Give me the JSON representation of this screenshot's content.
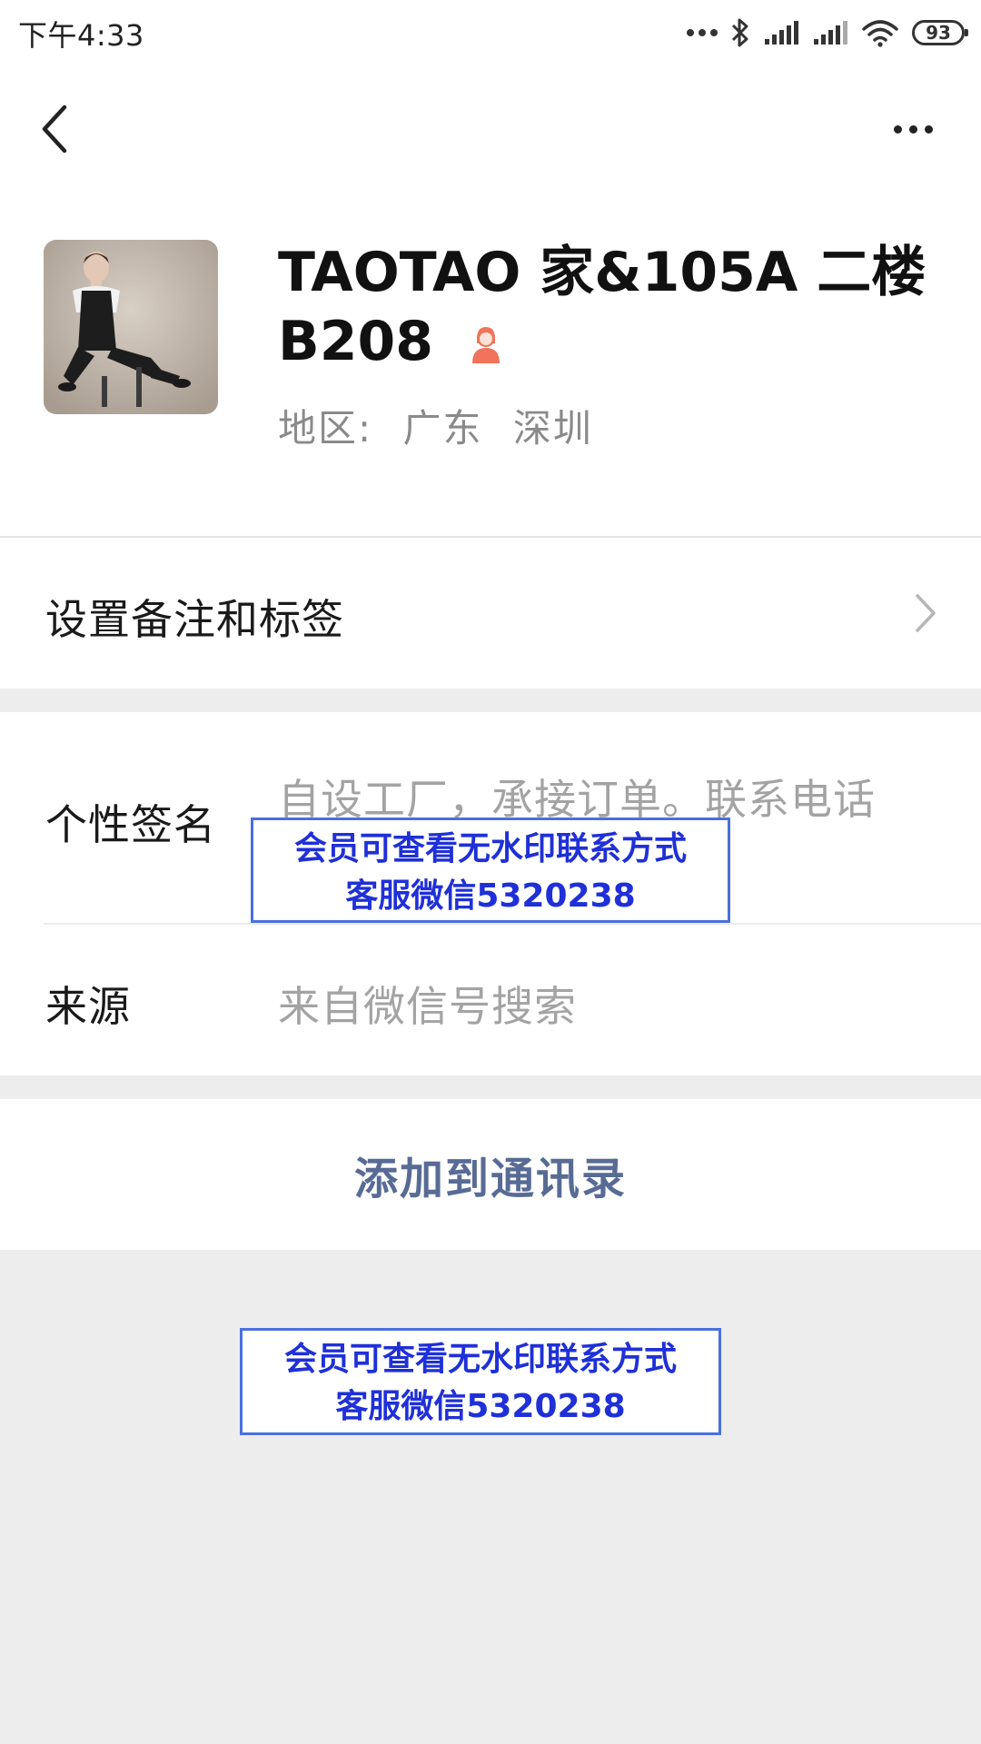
{
  "status_bar": {
    "time": "下午4:33",
    "battery": "93",
    "icons": [
      "more-dots-icon",
      "bluetooth-icon",
      "signal-icon",
      "signal-icon",
      "wifi-icon",
      "battery-icon"
    ]
  },
  "nav": {
    "back_icon": "chevron-left-icon",
    "more_icon": "more-icon"
  },
  "profile": {
    "name": "TAOTAO 家&105A 二楼 B208",
    "gender_icon": "female-icon",
    "gender_color": "#f0735a",
    "region_label": "地区:",
    "region_province": "广东",
    "region_city": "深圳"
  },
  "remark": {
    "label": "设置备注和标签"
  },
  "signature": {
    "label": "个性签名",
    "value": "自设工厂，承接订单。联系电话"
  },
  "source": {
    "label": "来源",
    "value": "来自微信号搜索"
  },
  "actions": {
    "add_contact": "添加到通讯录"
  },
  "watermark": {
    "line1": "会员可查看无水印联系方式",
    "line2": "客服微信5320238"
  },
  "colors": {
    "link": "#576b95",
    "watermark_text": "#1f30d8",
    "watermark_border": "#4a6fe0",
    "background": "#ededed"
  }
}
